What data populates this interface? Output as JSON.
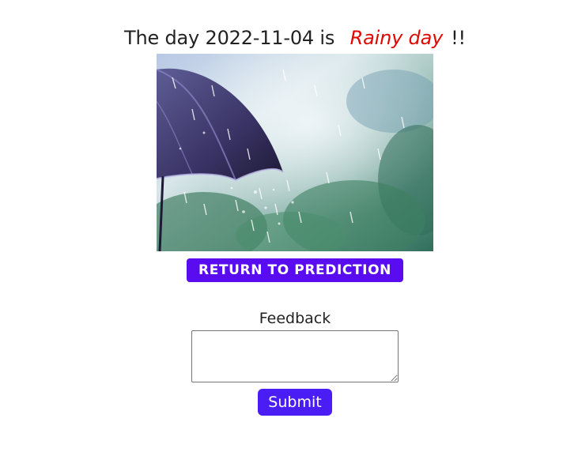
{
  "result": {
    "prefix": "The day",
    "date": "2022-11-04",
    "verb": "is",
    "weather": "Rainy day",
    "suffix": "!!"
  },
  "image": {
    "subject": "umbrella in heavy rain",
    "icon": "rain-umbrella-image"
  },
  "buttons": {
    "return_label": "RETURN TO PREDICTION",
    "submit_label": "Submit"
  },
  "feedback": {
    "label": "Feedback",
    "value": ""
  },
  "colors": {
    "weather_text": "#e10600",
    "return_button": "#5a0cf0",
    "submit_button": "#4a1df5"
  }
}
